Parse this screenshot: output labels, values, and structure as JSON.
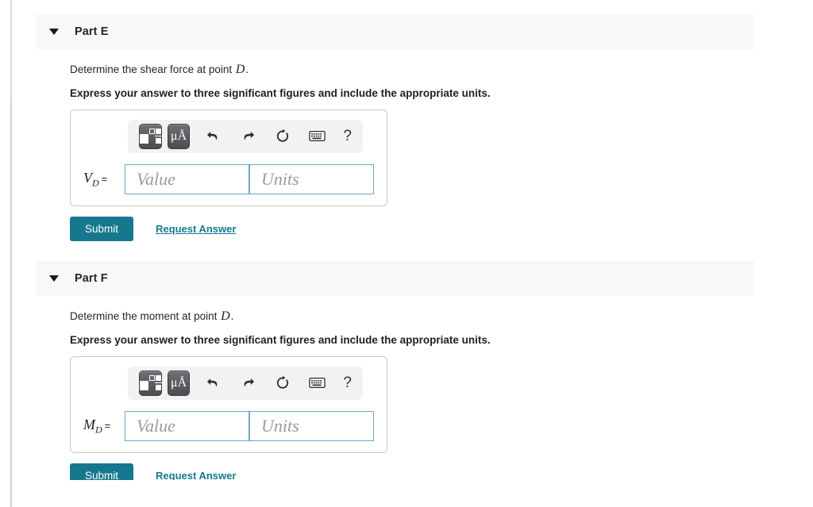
{
  "page": {
    "background": "#ffffff",
    "accent_color": "#16788f",
    "header_band_color": "#f8f8f8",
    "field_border_color": "#6da8c4"
  },
  "parts": [
    {
      "id": "part-e",
      "title": "Part E",
      "caret": "caret-down-icon",
      "prompt_prefix": "Determine the shear force at point ",
      "prompt_variable": "D",
      "prompt_suffix": ".",
      "instruction": "Express your answer to three significant figures and include the appropriate units.",
      "toolbar": {
        "template_button": "math-template-icon",
        "units_button": "μÅ",
        "undo": "undo-icon",
        "redo": "redo-icon",
        "reset": "reset-icon",
        "keyboard": "keyboard-icon",
        "help": "?"
      },
      "answer": {
        "variable": "V",
        "subscript": "D",
        "equals": "=",
        "value_input": {
          "value": "",
          "placeholder": "Value"
        },
        "units_input": {
          "value": "",
          "placeholder": "Units"
        }
      },
      "submit_label": "Submit",
      "request_answer_label": "Request Answer"
    },
    {
      "id": "part-f",
      "title": "Part F",
      "caret": "caret-down-icon",
      "prompt_prefix": "Determine the moment at point ",
      "prompt_variable": "D",
      "prompt_suffix": ".",
      "instruction": "Express your answer to three significant figures and include the appropriate units.",
      "toolbar": {
        "template_button": "math-template-icon",
        "units_button": "μÅ",
        "undo": "undo-icon",
        "redo": "redo-icon",
        "reset": "reset-icon",
        "keyboard": "keyboard-icon",
        "help": "?"
      },
      "answer": {
        "variable": "M",
        "subscript": "D",
        "equals": "=",
        "value_input": {
          "value": "",
          "placeholder": "Value"
        },
        "units_input": {
          "value": "",
          "placeholder": "Units"
        }
      },
      "submit_label": "Submit",
      "request_answer_label": "Request Answer"
    }
  ]
}
